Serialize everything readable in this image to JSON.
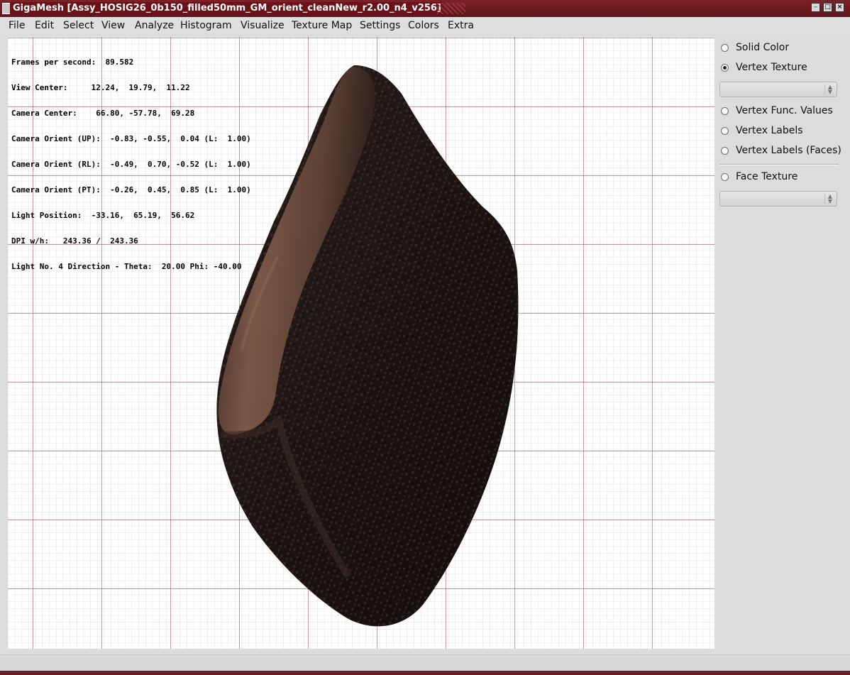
{
  "window": {
    "title": "GigaMesh [Assy_HOSIG26_0b150_filled50mm_GM_orient_cleanNew_r2.00_n4_v256]",
    "controls": {
      "minimize": "–",
      "maximize": "□",
      "close": "×"
    }
  },
  "menu": [
    "File",
    "Edit",
    "Select",
    "View",
    "Analyze",
    "Histogram",
    "Visualize",
    "Texture Map",
    "Settings",
    "Colors",
    "Extra"
  ],
  "viewport": {
    "info_lines": [
      "Frames per second:  89.582",
      "View Center:     12.24,  19.79,  11.22",
      "Camera Center:    66.80, -57.78,  69.28",
      "Camera Orient (UP):  -0.83, -0.55,  0.04 (L:  1.00)",
      "Camera Orient (RL):  -0.49,  0.70, -0.52 (L:  1.00)",
      "Camera Orient (PT):  -0.26,  0.45,  0.85 (L:  1.00)",
      "Light Position:  -33.16,  65.19,  56.62",
      "DPI w/h:   243.36 /  243.36",
      "Light No. 4 Direction - Theta:  20.00 Phi: -40.00"
    ],
    "grid_colors": {
      "minor": "#c9bcbf",
      "major": "#7a2b33"
    }
  },
  "panel": {
    "options": [
      {
        "label": "Solid Color",
        "checked": false
      },
      {
        "label": "Vertex Texture",
        "checked": true
      },
      {
        "label": "Vertex Func. Values",
        "checked": false
      },
      {
        "label": "Vertex Labels",
        "checked": false
      },
      {
        "label": "Vertex Labels (Faces)",
        "checked": false
      },
      {
        "label": "Face Texture",
        "checked": false
      }
    ],
    "vertex_texture_select": "",
    "face_texture_select": ""
  },
  "status": {
    "text": ""
  }
}
